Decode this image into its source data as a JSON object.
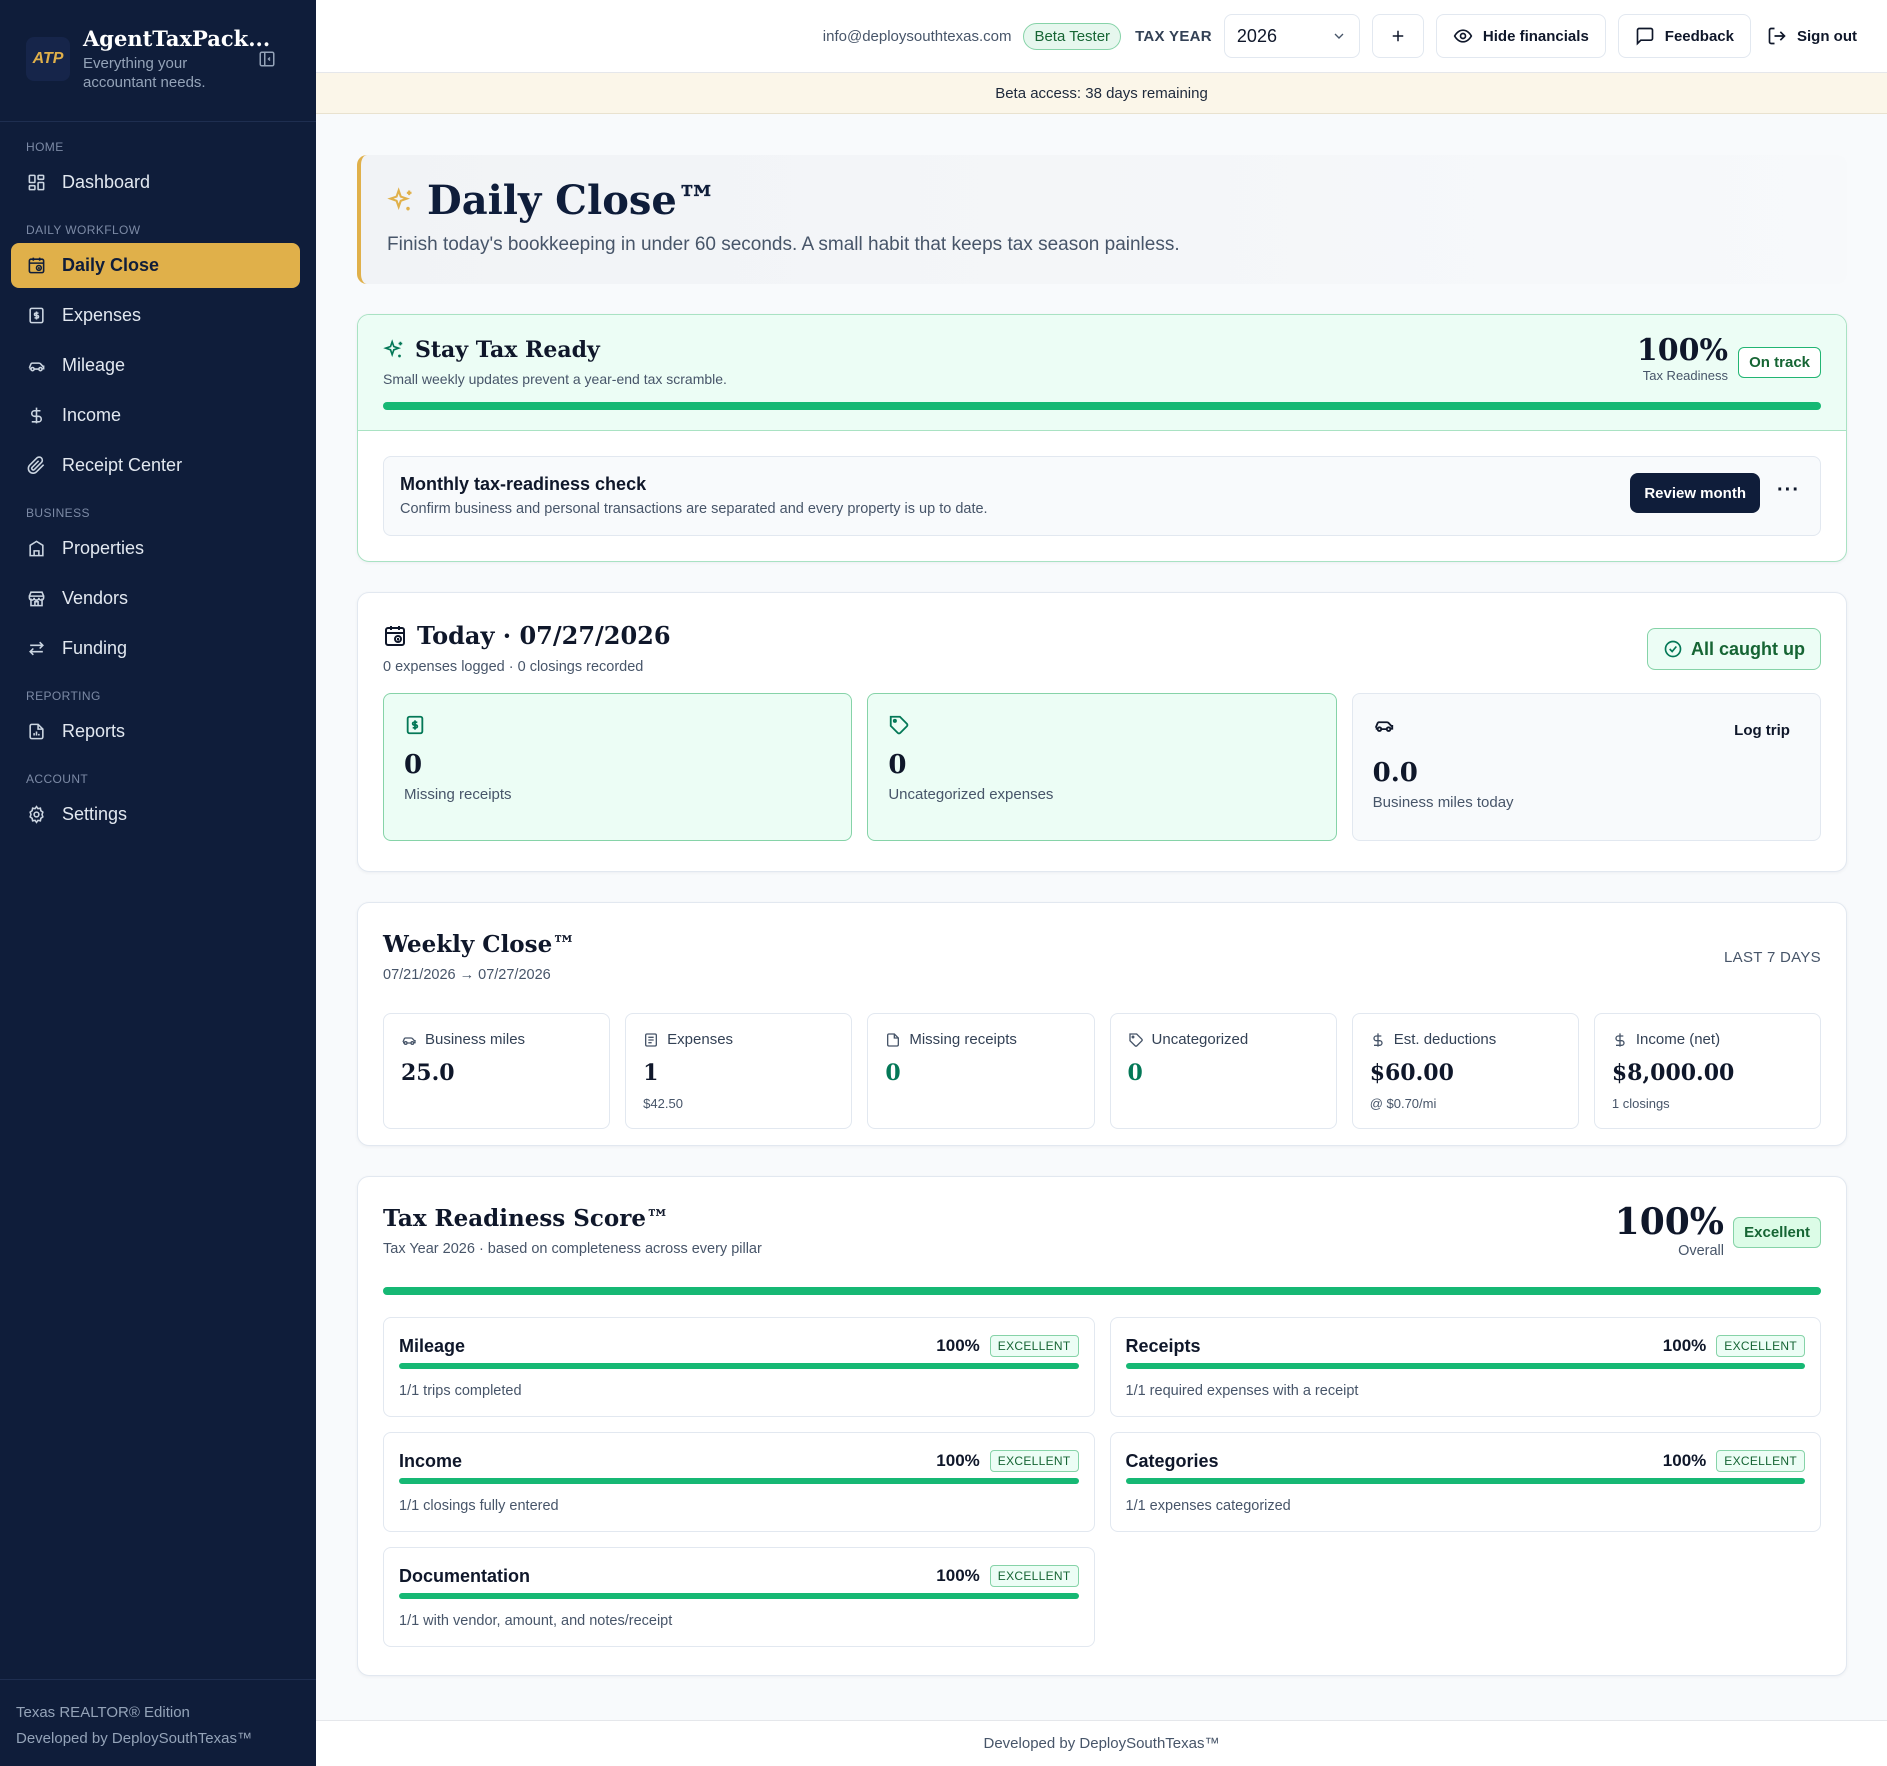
{
  "brand": {
    "logo": "ATP",
    "name": "AgentTaxPack...",
    "tagline": "Everything your accountant needs."
  },
  "sidebar": {
    "sections": {
      "home": "HOME",
      "daily": "DAILY WORKFLOW",
      "business": "BUSINESS",
      "reporting": "REPORTING",
      "account": "ACCOUNT"
    },
    "items": {
      "dashboard": "Dashboard",
      "daily_close": "Daily Close",
      "expenses": "Expenses",
      "mileage": "Mileage",
      "income": "Income",
      "receipt_center": "Receipt Center",
      "properties": "Properties",
      "vendors": "Vendors",
      "funding": "Funding",
      "reports": "Reports",
      "settings": "Settings"
    },
    "footer": {
      "edition": "Texas REALTOR® Edition",
      "dev": "Developed by DeploySouthTexas™"
    },
    "active_color": "#e0b04a"
  },
  "topbar": {
    "email": "info@deploysouthtexas.com",
    "badge": "Beta Tester",
    "tax_year_label": "TAX YEAR",
    "tax_year_value": "2026",
    "hide_financials": "Hide financials",
    "feedback": "Feedback",
    "sign_out": "Sign out"
  },
  "banner": "Beta access: 38 days remaining",
  "hero": {
    "title": "Daily Close™",
    "subtitle": "Finish today's bookkeeping in under 60 seconds. A small habit that keeps tax season painless."
  },
  "stay_ready": {
    "title": "Stay Tax Ready",
    "subtitle": "Small weekly updates prevent a year-end tax scramble.",
    "score": "100%",
    "score_label": "Tax Readiness",
    "status": "On track",
    "progress": 1.0,
    "check_title": "Monthly tax-readiness check",
    "check_sub": "Confirm business and personal transactions are separated and every property is up to date.",
    "review_btn": "Review month",
    "more": "···"
  },
  "today": {
    "title": "Today · 07/27/2026",
    "subtitle": "0 expenses logged · 0 closings recorded",
    "status": "All caught up",
    "tiles": [
      {
        "value": "0",
        "label": "Missing receipts"
      },
      {
        "value": "0",
        "label": "Uncategorized expenses"
      },
      {
        "value": "0.0",
        "label": "Business miles today",
        "action": "Log trip"
      }
    ]
  },
  "weekly": {
    "title": "Weekly Close™",
    "range": "07/21/2026 → 07/27/2026",
    "period": "LAST 7 DAYS",
    "tiles": [
      {
        "label": "Business miles",
        "value": "25.0",
        "note": ""
      },
      {
        "label": "Expenses",
        "value": "1",
        "note": "$42.50"
      },
      {
        "label": "Missing receipts",
        "value": "0",
        "note": ""
      },
      {
        "label": "Uncategorized",
        "value": "0",
        "note": ""
      },
      {
        "label": "Est. deductions",
        "value": "$60.00",
        "note": "@ $0.70/mi"
      },
      {
        "label": "Income (net)",
        "value": "$8,000.00",
        "note": "1 closings"
      }
    ]
  },
  "readiness": {
    "title": "Tax Readiness Score™",
    "subtitle": "Tax Year 2026 · based on completeness across every pillar",
    "score": "100%",
    "score_label": "Overall",
    "status": "Excellent",
    "progress": 1.0,
    "pillars": [
      {
        "name": "Mileage",
        "pct": "100%",
        "badge": "EXCELLENT",
        "note": "1/1 trips completed"
      },
      {
        "name": "Receipts",
        "pct": "100%",
        "badge": "EXCELLENT",
        "note": "1/1 required expenses with a receipt"
      },
      {
        "name": "Income",
        "pct": "100%",
        "badge": "EXCELLENT",
        "note": "1/1 closings fully entered"
      },
      {
        "name": "Categories",
        "pct": "100%",
        "badge": "EXCELLENT",
        "note": "1/1 expenses categorized"
      },
      {
        "name": "Documentation",
        "pct": "100%",
        "badge": "EXCELLENT",
        "note": "1/1 with vendor, amount, and notes/receipt"
      }
    ]
  },
  "footer": "Developed by DeploySouthTexas™",
  "colors": {
    "navy": "#0f1d3a",
    "gold": "#e0b04a",
    "green": "#16b874",
    "mint": "#ecfdf5"
  }
}
